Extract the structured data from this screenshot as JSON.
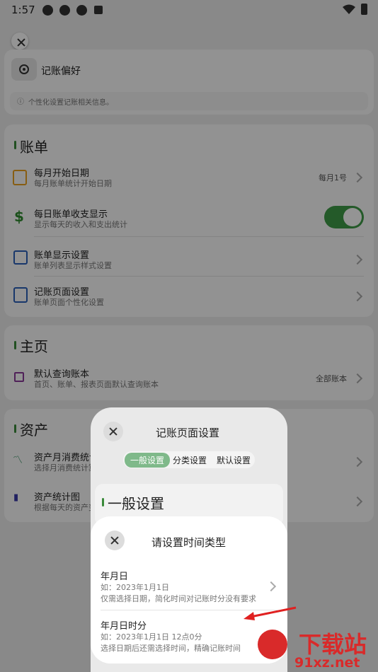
{
  "status": {
    "time": "1:57"
  },
  "prefs": {
    "title": "记账偏好",
    "hint": "个性化设置记账相关信息。"
  },
  "bill": {
    "section": "账单",
    "rows": [
      {
        "title": "每月开始日期",
        "sub": "每月账单统计开始日期",
        "value": "每月1号"
      },
      {
        "title": "每日账单收支显示",
        "sub": "显示每天的收入和支出统计",
        "toggle": true
      },
      {
        "title": "账单显示设置",
        "sub": "账单列表显示样式设置"
      },
      {
        "title": "记账页面设置",
        "sub": "账单页面个性化设置"
      }
    ]
  },
  "home": {
    "section": "主页",
    "rows": [
      {
        "title": "默认查询账本",
        "sub": "首页、账单、报表页面默认查询账本",
        "value": "全部账本"
      }
    ]
  },
  "assets": {
    "section": "资产",
    "rows": [
      {
        "title": "资产月消费统计",
        "sub": "选择月消费统计算"
      },
      {
        "title": "资产统计图",
        "sub": "根据每天的资产变"
      }
    ]
  },
  "sheet1": {
    "title": "记账页面设置",
    "tabs": [
      "一般设置",
      "分类设置",
      "默认设置"
    ],
    "section": "一般设置"
  },
  "sheet2": {
    "title": "请设置时间类型",
    "options": [
      {
        "title": "年月日",
        "example": "如：2023年1月1日",
        "desc": "仅需选择日期，简化时间对记账时分没有要求"
      },
      {
        "title": "年月日时分",
        "example": "如：2023年1月1日 12点0分",
        "desc": "选择日期后还需选择时间，精确记账时间"
      }
    ]
  },
  "watermark": {
    "brand": "下载站",
    "url": "91xz.net"
  },
  "colors": {
    "accent": "#3f9b47",
    "arrow": "#e02020"
  }
}
